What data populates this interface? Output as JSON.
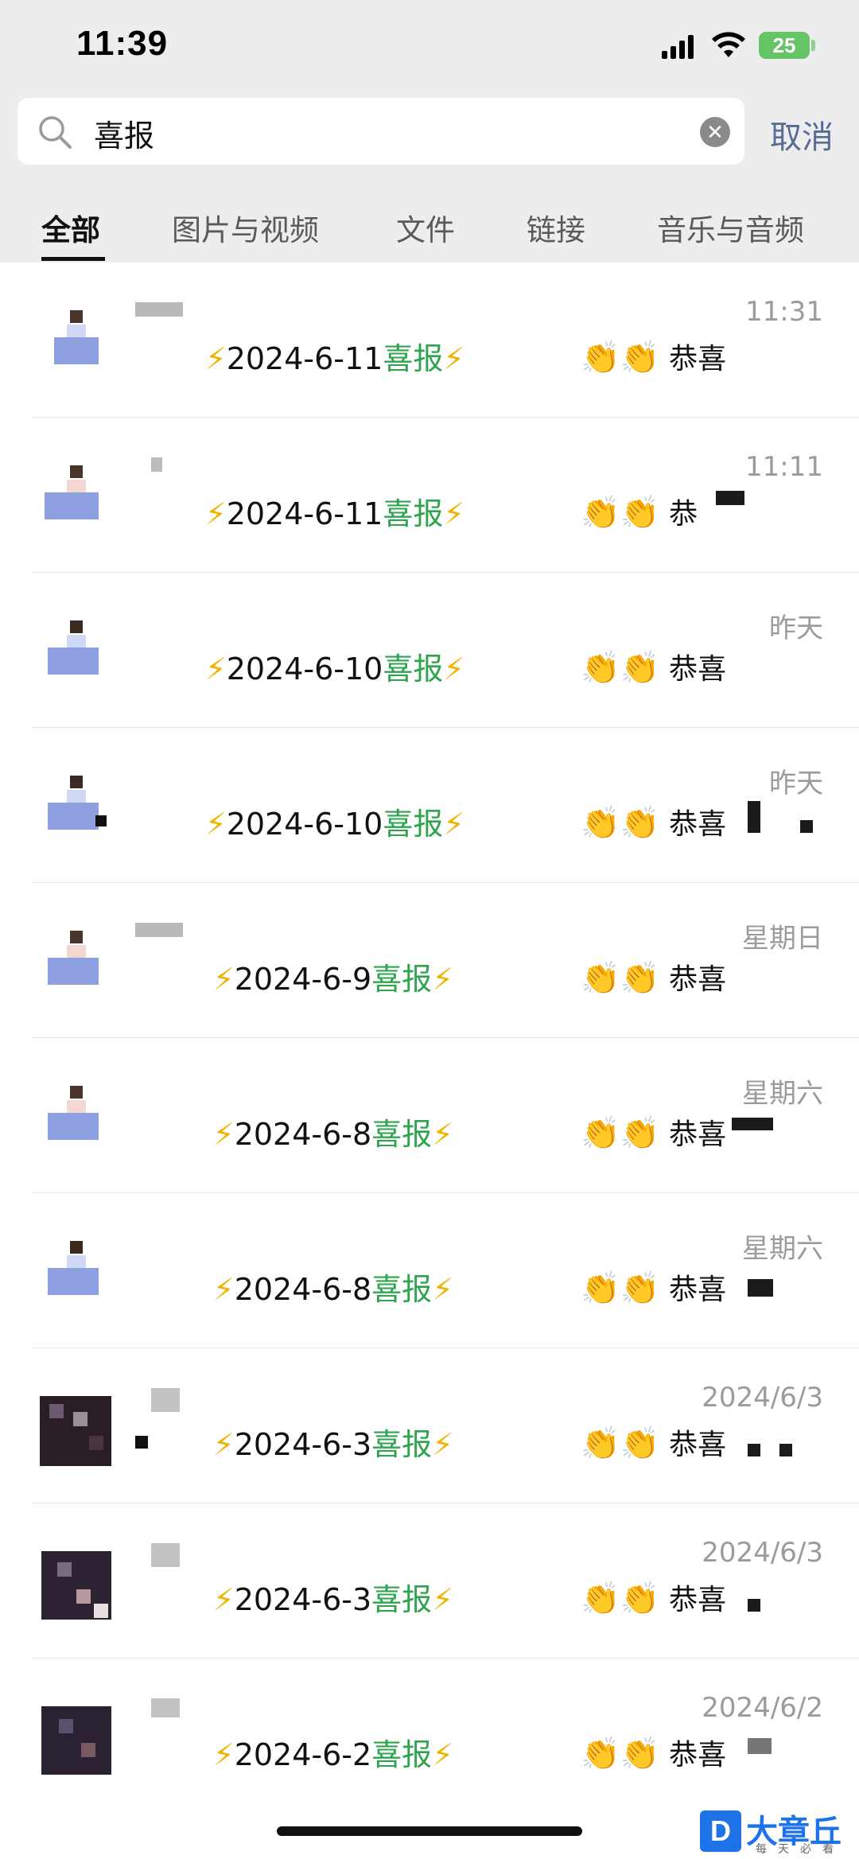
{
  "status": {
    "time": "11:39",
    "battery": "25"
  },
  "search": {
    "query": "喜报",
    "cancel_label": "取消"
  },
  "tabs": [
    {
      "label": "全部",
      "active": true
    },
    {
      "label": "图片与视频",
      "active": false
    },
    {
      "label": "文件",
      "active": false
    },
    {
      "label": "链接",
      "active": false
    },
    {
      "label": "音乐与音频",
      "active": false
    }
  ],
  "results": [
    {
      "time": "11:31",
      "date": "2024-6-11",
      "keyword": "喜报",
      "congrats": "恭喜"
    },
    {
      "time": "11:11",
      "date": "2024-6-11",
      "keyword": "喜报",
      "congrats": "恭"
    },
    {
      "time": "昨天",
      "date": "2024-6-10",
      "keyword": "喜报",
      "congrats": "恭喜"
    },
    {
      "time": "昨天",
      "date": "2024-6-10",
      "keyword": "喜报",
      "congrats": "恭喜"
    },
    {
      "time": "星期日",
      "date": "2024-6-9",
      "keyword": "喜报",
      "congrats": "恭喜"
    },
    {
      "time": "星期六",
      "date": "2024-6-8",
      "keyword": "喜报",
      "congrats": "恭喜"
    },
    {
      "time": "星期六",
      "date": "2024-6-8",
      "keyword": "喜报",
      "congrats": "恭喜"
    },
    {
      "time": "2024/6/3",
      "date": "2024-6-3",
      "keyword": "喜报",
      "congrats": "恭喜"
    },
    {
      "time": "2024/6/3",
      "date": "2024-6-3",
      "keyword": "喜报",
      "congrats": "恭喜"
    },
    {
      "time": "2024/6/2",
      "date": "2024-6-2",
      "keyword": "喜报",
      "congrats": "恭喜"
    }
  ],
  "colors": {
    "highlight": "#2fa44f",
    "link": "#576b95",
    "bolt": "#f0b400"
  },
  "watermark": {
    "logo": "D",
    "name": "大章丘",
    "tagline": "每天必看"
  }
}
